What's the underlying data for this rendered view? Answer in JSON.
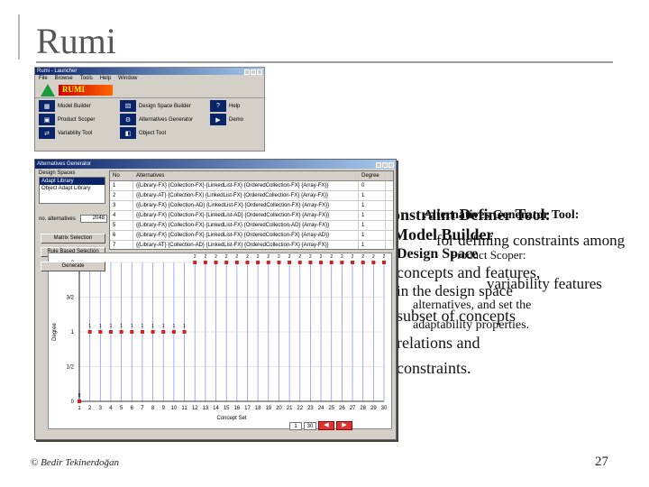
{
  "slide": {
    "title": "Rumi",
    "footer": "© Bedir Tekinerdoğan",
    "page_number": "27"
  },
  "overlap_text": {
    "l1a": "Constraint Definer Tool:",
    "l1b": "Alternatives Generator Tool:",
    "l2a": "Model Builder",
    "l2b": "for defining constraints among",
    "l3a": "Design Space",
    "l3b": "Product Scoper:",
    "l4a": "concepts and features,",
    "l5a": "in the design space",
    "l5b": "variability features",
    "l6a": "alternatives, and set the",
    "l7a": "subset of concepts",
    "l7b": "adaptability properties.",
    "l8a": "relations and",
    "l9a": "constraints."
  },
  "launcher": {
    "title": "Rumi - Launcher",
    "menu": [
      "File",
      "Browse",
      "Tools",
      "Help",
      "Window"
    ],
    "logo": "RUMI",
    "tools": [
      {
        "label": "Model Builder",
        "icon": "model-builder-icon",
        "glyph": "▦"
      },
      {
        "label": "Design Space Builder",
        "icon": "design-space-builder-icon",
        "glyph": "⚄"
      },
      {
        "label": "Help",
        "icon": "help-icon",
        "glyph": "?"
      },
      {
        "label": "Product Scoper",
        "icon": "product-scoper-icon",
        "glyph": "▣"
      },
      {
        "label": "Alternatives Generator",
        "icon": "alternatives-generator-icon",
        "glyph": "⚙"
      },
      {
        "label": "Demo",
        "icon": "demo-icon",
        "glyph": "▶"
      },
      {
        "label": "Variability Tool",
        "icon": "variability-tool-icon",
        "glyph": "⇄"
      },
      {
        "label": "Object Tool",
        "icon": "object-tool-icon",
        "glyph": "◧"
      }
    ]
  },
  "alternatives_window": {
    "title": "Alternatives Generator",
    "design_spaces_label": "Design Spaces",
    "design_spaces": [
      "Adapt Library",
      "Object Adapt Library"
    ],
    "no_alternatives_label": "no. alternatives",
    "no_alternatives_value": "2048",
    "buttons": [
      "Matrix Selection",
      "Rule Based Selection",
      "Generate"
    ],
    "table": {
      "headers": [
        "No",
        "Alternatives",
        "Degree"
      ],
      "rows": [
        [
          "1",
          "{{Library-FX} {Collection-FX} {LinkedList-FX} {OrderedCollection-FX} {Array-FX}}",
          "0"
        ],
        [
          "2",
          "{{Library-AT} {Collection-FX} {LinkedList-FX} {OrderedCollection-FX} {Array-FX}}",
          "1"
        ],
        [
          "3",
          "{{Library-FX} {Collection-AD} {LinkedList-FX} {OrderedCollection-FX} {Array-FX}}",
          "1"
        ],
        [
          "4",
          "{{Library-FX} {Collection-FX} {LinkedList-AD} {OrderedCollection-FX} {Array-FX}}",
          "1"
        ],
        [
          "5",
          "{{Library-FX} {Collection-FX} {LinkedList-FX} {OrderedCollection-AD} {Array-FX}}",
          "1"
        ],
        [
          "6",
          "{{Library-FX} {Collection-FX} {LinkedList-FX} {OrderedCollection-FX} {Array-AD}}",
          "1"
        ],
        [
          "7",
          "{{Library-AT} {Collection-AD} {LinkedList-FX} {OrderedCollection-FX} {Array-FX}}",
          "1"
        ]
      ]
    },
    "pager": {
      "from": "1",
      "to": "30"
    }
  },
  "chart_data": {
    "type": "scatter",
    "xlabel": "Concept Set",
    "ylabel": "Degree",
    "y_tick_labels": [
      "0",
      "1/2",
      "1",
      "3/2",
      "2"
    ],
    "x_tick_labels": [
      "1",
      "2",
      "3",
      "4",
      "5",
      "6",
      "7",
      "8",
      "9",
      "10",
      "11",
      "12",
      "13",
      "14",
      "15",
      "16",
      "17",
      "18",
      "19",
      "20",
      "21",
      "22",
      "23",
      "24",
      "25",
      "26",
      "27",
      "28",
      "29",
      "30"
    ],
    "xlim": [
      1,
      30
    ],
    "ylim": [
      0,
      2
    ],
    "grid": true,
    "x": [
      1,
      2,
      3,
      4,
      5,
      6,
      7,
      8,
      9,
      10,
      11,
      12,
      13,
      14,
      15,
      16,
      17,
      18,
      19,
      20,
      21,
      22,
      23,
      24,
      25,
      26,
      27,
      28,
      29,
      30
    ],
    "y": [
      0,
      1,
      1,
      1,
      1,
      1,
      1,
      1,
      1,
      1,
      1,
      2,
      2,
      2,
      2,
      2,
      2,
      2,
      2,
      2,
      2,
      2,
      2,
      2,
      2,
      2,
      2,
      2,
      2,
      2
    ],
    "point_labels": [
      "0",
      "1",
      "1",
      "1",
      "1",
      "1",
      "1",
      "1",
      "1",
      "1",
      "1",
      "2",
      "2",
      "2",
      "2",
      "2",
      "2",
      "2",
      "2",
      "2",
      "2",
      "2",
      "2",
      "2",
      "2",
      "2",
      "2",
      "2",
      "2",
      "2"
    ],
    "point_color": "#cc2222",
    "grid_color": "#8899ee"
  }
}
